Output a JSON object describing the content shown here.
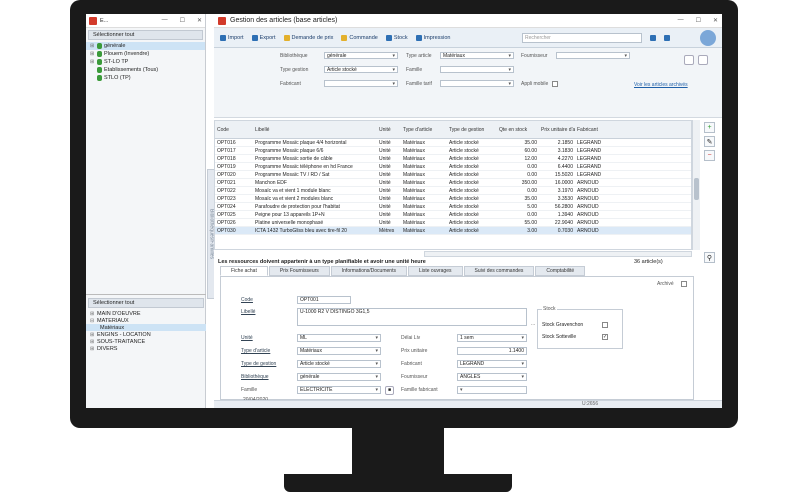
{
  "left": {
    "title": "E...",
    "select_all_top": "Sélectionner tout",
    "tree_top": [
      "générale",
      "Plouem (Invendre)",
      "ST-LO TP",
      "Etablissements (Tous)",
      "STLO (TP)"
    ],
    "sidetab": "Bibliothèques/Familles",
    "select_all_bottom": "Sélectionner tout",
    "tree_bottom": [
      "MAIN D'OEUVRE",
      "MATERIAUX",
      "Matériaux",
      "ENGINS - LOCATION",
      "SOUS-TRAITANCE",
      "DIVERS"
    ]
  },
  "main": {
    "title": "Gestion des articles (base articles)",
    "toolbar": {
      "import": "Import",
      "export": "Export",
      "demande": "Demande de prix",
      "commande": "Commande",
      "stock": "Stock",
      "impression": "Impression",
      "search_placeholder": "Rechercher"
    },
    "filters": {
      "bibliotheque_lbl": "Bibliothèque",
      "bibliotheque_val": "générale",
      "type_gestion_lbl": "Type gestion",
      "type_gestion_val": "Article stocké",
      "fabricant_lbl": "Fabricant",
      "type_article_lbl": "Type article",
      "type_article_val": "Matériaux",
      "famille_lbl": "Famille",
      "famille_tarif_lbl": "Famille tarif",
      "fournisseur_lbl": "Fournisseur",
      "appli_mobile_lbl": "Appli mobile",
      "link": "Voir les articles archivés"
    },
    "grid": {
      "headers": [
        "Code",
        "Libellé",
        "Unité",
        "Type d'article",
        "Type de gestion",
        "Qte en stock",
        "Prix unitaire d'achat",
        "Fabricant"
      ],
      "rows": [
        [
          "OPT016",
          "Programme Mosaïc plaque 4/4 horizontal",
          "Unité",
          "Matériaux",
          "Article stocké",
          "35.00",
          "2.1850",
          "LEGRAND"
        ],
        [
          "OPT017",
          "Programme Mosaïc plaque 6/6",
          "Unité",
          "Matériaux",
          "Article stocké",
          "60.00",
          "3.1830",
          "LEGRAND"
        ],
        [
          "OPT018",
          "Programme Mosaïc sortie de câble",
          "Unité",
          "Matériaux",
          "Article stocké",
          "12.00",
          "4.2270",
          "LEGRAND"
        ],
        [
          "OPT019",
          "Programme Mosaïc téléphone en hd France",
          "Unité",
          "Matériaux",
          "Article stocké",
          "0.00",
          "6.4400",
          "LEGRAND"
        ],
        [
          "OPT020",
          "Programme Mosaïc TV / RD / Sat",
          "Unité",
          "Matériaux",
          "Article stocké",
          "0.00",
          "15.5020",
          "LEGRAND"
        ],
        [
          "OPT021",
          "Manchon EDF",
          "Unité",
          "Matériaux",
          "Article stocké",
          "350.00",
          "16.0000",
          "ARNOUD"
        ],
        [
          "OPT022",
          "Mosaïc va et vient 1 module blanc",
          "Unité",
          "Matériaux",
          "Article stocké",
          "0.00",
          "3.1970",
          "ARNOUD"
        ],
        [
          "OPT023",
          "Mosaïc va et vient 2 modules blanc",
          "Unité",
          "Matériaux",
          "Article stocké",
          "35.00",
          "3.3530",
          "ARNOUD"
        ],
        [
          "OPT024",
          "Parafoudre de protection pour l'habitat",
          "Unité",
          "Matériaux",
          "Article stocké",
          "5.00",
          "56.2800",
          "ARNOUD"
        ],
        [
          "OPT025",
          "Peigne pour 13 appareils 1P+N",
          "Unité",
          "Matériaux",
          "Article stocké",
          "0.00",
          "1.3940",
          "ARNOUD"
        ],
        [
          "OPT026",
          "Platine universelle monophasé",
          "Unité",
          "Matériaux",
          "Article stocké",
          "55.00",
          "22.9040",
          "ARNOUD"
        ],
        [
          "OPT030",
          "ICTA 1432 TurboGliss bleu avec tire-fil 20",
          "Mètres",
          "Matériaux",
          "Article stocké",
          "3.00",
          "0.7030",
          "ARNOUD"
        ]
      ]
    },
    "note": "Les ressources doivent appartenir à un type planifiable et avoir une unité heure",
    "count": "36 article(s)",
    "tabs": [
      "Fiche achat",
      "Prix Fournisseurs",
      "Informations/Documents",
      "Liste ouvrages",
      "Suivi des commandes",
      "Comptabilité"
    ],
    "detail": {
      "archive_lbl": "Archivé",
      "code_lbl": "Code",
      "code_val": "OPT001",
      "libelle_lbl": "Libellé",
      "libelle_val": "U-1000 R2 V DISTINGO 3G1,5",
      "unite_lbl": "Unité",
      "unite_val": "ML",
      "type_article_lbl": "Type d'article",
      "type_article_val": "Matériaux",
      "type_gestion_lbl": "Type de gestion",
      "type_gestion_val": "Article stocké",
      "bibliotheque_lbl": "Bibliothèque",
      "bibliotheque_val": "générale",
      "famille_lbl": "Famille",
      "famille_val": "ELECTRICITE",
      "delai_lbl": "Délai Liv",
      "delai_val": "1 sem",
      "prix_lbl": "Prix unitaire",
      "prix_val": "1.1400",
      "fabricant_lbl": "Fabricant",
      "fabricant_val": "LEGRAND",
      "fournisseur_lbl": "Fournisseur",
      "fournisseur_val": "ANGLES",
      "famille_fab_lbl": "Famille fabricant",
      "date": "20/04/2020",
      "stock_title": "Stock",
      "stock1": "Stock Gravenchon",
      "stock2": "Stock Sotteville"
    },
    "status": "U:2656"
  }
}
